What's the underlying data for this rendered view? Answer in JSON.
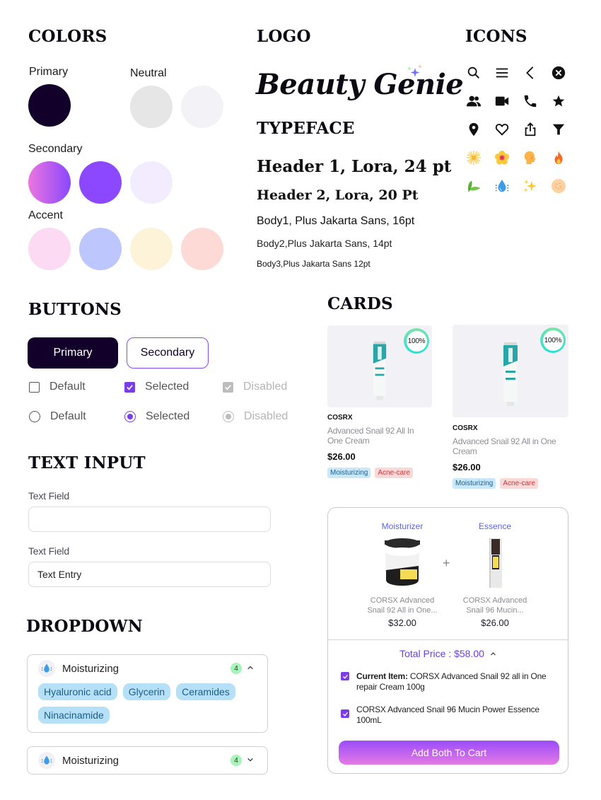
{
  "colors_section": {
    "title": "COLORS",
    "primary_label": "Primary",
    "neutral_label": "Neutral",
    "secondary_label": "Secondary",
    "accent_label": "Accent",
    "primary": [
      "#12002b"
    ],
    "neutral": [
      "#e6e6e6",
      "#f3f2f7"
    ],
    "secondary": [
      "gradient:#ec75e0-#8a48fc",
      "#8c48fe",
      "#f2ecfe"
    ],
    "accent": [
      "#fcdaf3",
      "#bec6fe",
      "#fcf3d9",
      "#fddad6"
    ]
  },
  "logo_section": {
    "title": "LOGO",
    "logo_text": "Beauty Genie",
    "logo_icon": "sparkle-icon"
  },
  "typeface_section": {
    "title": "TYPEFACE",
    "samples": [
      "Header 1, Lora, 24 pt",
      "Header 2, Lora, 20 Pt",
      "Body1, Plus Jakarta Sans, 16pt",
      "Body2,Plus Jakarta Sans, 14pt",
      "Body3,Plus Jakarta Sans 12pt"
    ]
  },
  "icons_section": {
    "title": "ICONS",
    "icons": [
      "search-icon",
      "menu-icon",
      "chevron-left-icon",
      "close-circle-icon",
      "people-icon",
      "video-camera-icon",
      "phone-icon",
      "star-icon",
      "location-pin-icon",
      "heart-icon",
      "share-icon",
      "filter-icon",
      "sunburst-icon",
      "flower-icon",
      "head-icon",
      "fire-icon",
      "leaf-icon",
      "water-drop-icon",
      "sparkles-icon",
      "skin-texture-icon"
    ]
  },
  "buttons_section": {
    "title": "BUTTONS",
    "primary_label": "Primary",
    "secondary_label": "Secondary",
    "checkbox_default": "Default",
    "checkbox_selected": "Selected",
    "checkbox_disabled": "Disabled",
    "radio_default": "Default",
    "radio_selected": "Selected",
    "radio_disabled": "Disabled"
  },
  "text_input_section": {
    "title": "TEXT INPUT",
    "field1_label": "Text Field",
    "field1_value": "",
    "field2_label": "Text Field",
    "field2_value": "Text Entry"
  },
  "dropdown_section": {
    "title": "DROPDOWN",
    "expanded": {
      "title": "Moisturizing",
      "count": "4",
      "chips": [
        "Hyaluronic acid",
        "Glycerin",
        "Ceramides",
        "Ninacinamide"
      ]
    },
    "collapsed": {
      "title": "Moisturizing",
      "count": "4"
    }
  },
  "cards_section": {
    "title": "CARDS",
    "cards": [
      {
        "match": "100%",
        "brand": "COSRX",
        "name": "Advanced Snail 92 All In One Cream",
        "price": "$26.00",
        "tags": [
          "Moisturizing",
          "Acne-care"
        ]
      },
      {
        "match": "100%",
        "brand": "COSRX",
        "name": "Advanced Snail 92 All in One Cream",
        "price": "$26.00",
        "tags": [
          "Moisturizing",
          "Acne-care"
        ]
      }
    ],
    "bundle": {
      "items": [
        {
          "category": "Moisturizer",
          "name": "CORSX Advanced Snail 92 All in One...",
          "price": "$32.00"
        },
        {
          "category": "Essence",
          "name": "CORSX Advanced Snail 96 Mucin...",
          "price": "$26.00"
        }
      ],
      "plus": "+",
      "total_label": "Total Price : $58.00",
      "checklist": [
        {
          "bold": "Current Item:",
          "text": " CORSX Advanced Snail 92 all in One repair Cream 100g",
          "checked": true
        },
        {
          "bold": "",
          "text": "CORSX Advanced Snail 96 Mucin Power Essence 100mL",
          "checked": true
        }
      ],
      "add_button": "Add Both To Cart"
    }
  }
}
